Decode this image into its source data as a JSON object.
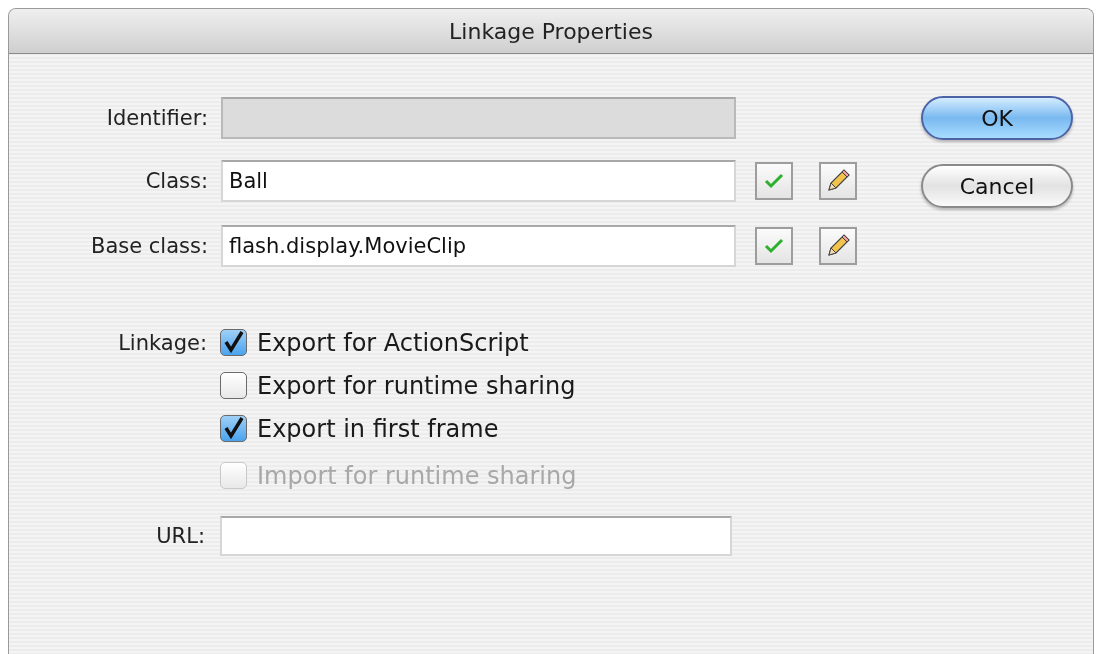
{
  "window": {
    "title": "Linkage Properties"
  },
  "fields": [
    {
      "label": "Identifier:",
      "disabled": true,
      "tools": false
    },
    {
      "label": "Class:",
      "value": "Ball",
      "disabled": false,
      "tools": true
    },
    {
      "label": "Base class:",
      "value": "flash.display.MovieClip",
      "disabled": false,
      "tools": true
    }
  ],
  "linkage": {
    "label": "Linkage:",
    "options": [
      {
        "label": "Export for ActionScript",
        "checked": true,
        "disabled": false
      },
      {
        "label": "Export for runtime sharing",
        "checked": false,
        "disabled": false
      },
      {
        "label": "Export in first frame",
        "checked": true,
        "disabled": false
      },
      {
        "label": "Import for runtime sharing",
        "checked": false,
        "disabled": true
      }
    ]
  },
  "url": {
    "label": "URL:"
  },
  "buttons": [
    {
      "label": "OK",
      "default": true
    },
    {
      "label": "Cancel",
      "default": false
    }
  ]
}
